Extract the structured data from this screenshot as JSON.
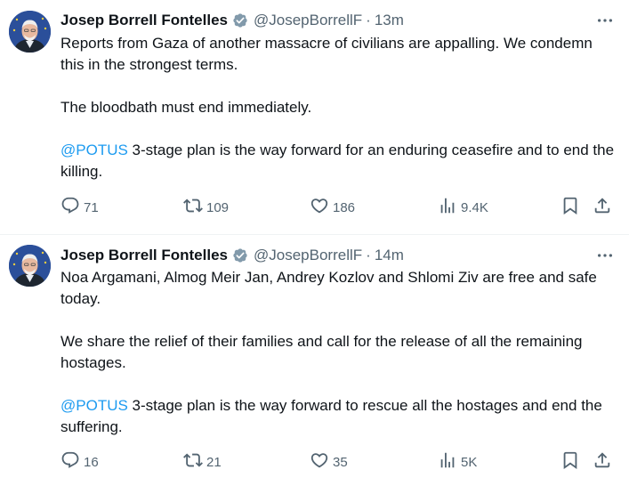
{
  "tweets": [
    {
      "author_name": "Josep Borrell Fontelles",
      "handle": "@JosepBorrellF",
      "separator": "·",
      "time": "13m",
      "paragraphs": [
        {
          "mention": "",
          "text": "Reports from Gaza of another massacre of civilians are appalling. We condemn this in the strongest terms."
        },
        {
          "mention": "",
          "text": "The bloodbath must end immediately."
        },
        {
          "mention": "@POTUS",
          "text": " 3-stage plan is the way forward for an enduring ceasefire  and to end the killing."
        }
      ],
      "stats": {
        "replies": "71",
        "reposts": "109",
        "likes": "186",
        "views": "9.4K"
      }
    },
    {
      "author_name": "Josep Borrell Fontelles",
      "handle": "@JosepBorrellF",
      "separator": "·",
      "time": "14m",
      "paragraphs": [
        {
          "mention": "",
          "text": "Noa Argamani, Almog Meir Jan, Andrey Kozlov and Shlomi Ziv are free and safe today."
        },
        {
          "mention": "",
          "text": "We share the relief of their families and call for the release of all the remaining hostages."
        },
        {
          "mention": "@POTUS",
          "text": " 3-stage plan is the way forward to rescue all the hostages and end the suffering."
        }
      ],
      "stats": {
        "replies": "16",
        "reposts": "21",
        "likes": "35",
        "views": "5K"
      }
    }
  ],
  "icons": {
    "verified": "verified-badge-icon",
    "more": "more-icon",
    "reply": "reply-icon",
    "repost": "repost-icon",
    "like": "like-icon",
    "views": "views-icon",
    "bookmark": "bookmark-icon",
    "share": "share-icon"
  },
  "colors": {
    "text": "#0f1419",
    "secondary": "#536471",
    "mention": "#1d9bf0",
    "verified": "#829aab",
    "avatar_bg": "#2b4f9a"
  }
}
